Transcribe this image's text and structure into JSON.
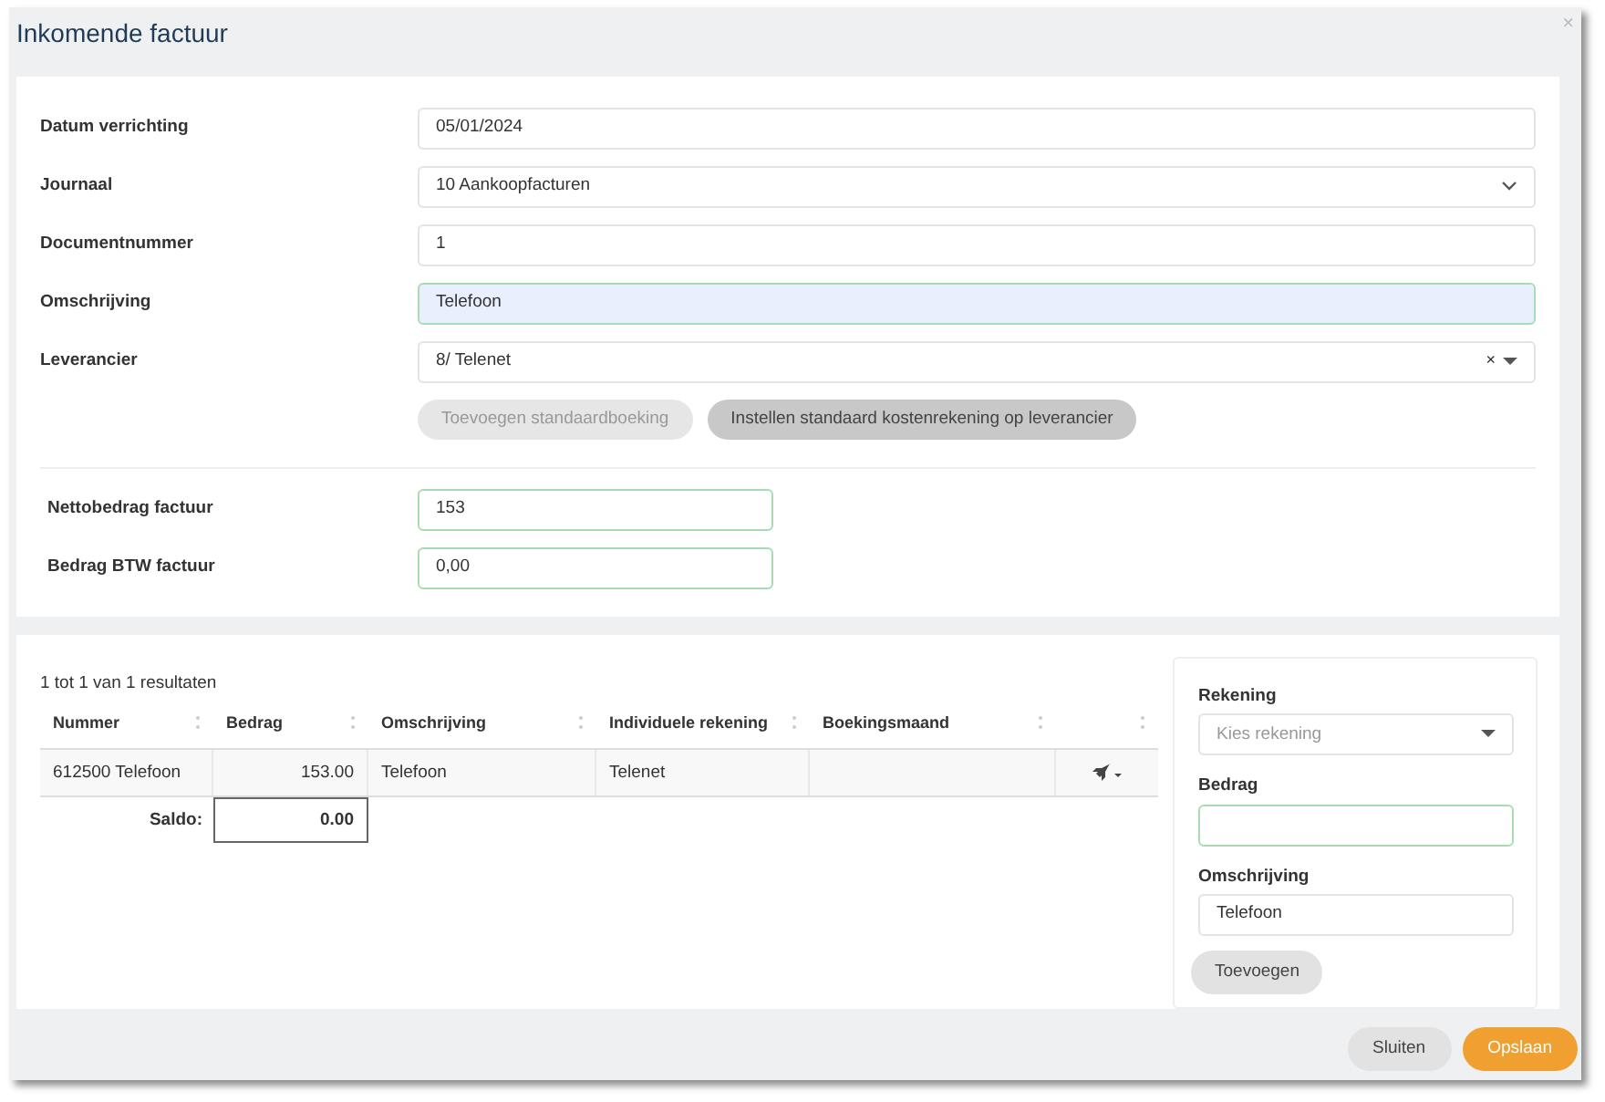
{
  "window": {
    "title": "Inkomende factuur",
    "close": "×"
  },
  "form": {
    "fields": [
      {
        "kind": "text",
        "label": "Datum verrichting",
        "value": "05/01/2024",
        "highlighted": false
      },
      {
        "kind": "select",
        "label": "Journaal",
        "value": "10 Aankoopfacturen",
        "highlighted": false
      },
      {
        "kind": "text",
        "label": "Documentnummer",
        "value": "1",
        "highlighted": false
      },
      {
        "kind": "text",
        "label": "Omschrijving",
        "value": "Telefoon",
        "highlighted": true
      },
      {
        "kind": "combo",
        "label": "Leverancier",
        "value": "8/ Telenet",
        "clear": "×",
        "highlighted": false
      }
    ],
    "buttons": [
      {
        "label": "Toevoegen standaardboeking",
        "disabled": true
      },
      {
        "label": "Instellen standaard kostenrekening op leverancier",
        "disabled": false
      }
    ],
    "amounts": [
      {
        "label": "Nettobedrag factuur",
        "value": "153"
      },
      {
        "label": "Bedrag BTW factuur",
        "value": "0,00"
      }
    ]
  },
  "table": {
    "summary": "1 tot 1 van 1 resultaten",
    "columns": [
      "Nummer",
      "Bedrag",
      "Omschrijving",
      "Individuele rekening",
      "Boekingsmaand"
    ],
    "rows": [
      {
        "cells": [
          "612500 Telefoon",
          "153.00",
          "Telefoon",
          "Telenet",
          ""
        ]
      }
    ],
    "saldo_label": "Saldo:",
    "saldo_value": "0.00"
  },
  "side_panel": {
    "account_label": "Rekening",
    "account_placeholder": "Kies rekening",
    "amount_label": "Bedrag",
    "description_label": "Omschrijving",
    "description_value": "Telefoon",
    "add_button": "Toevoegen"
  },
  "footer": {
    "buttons": [
      {
        "label": "Sluiten",
        "kind": "secondary"
      },
      {
        "label": "Opslaan",
        "kind": "primary"
      }
    ]
  }
}
